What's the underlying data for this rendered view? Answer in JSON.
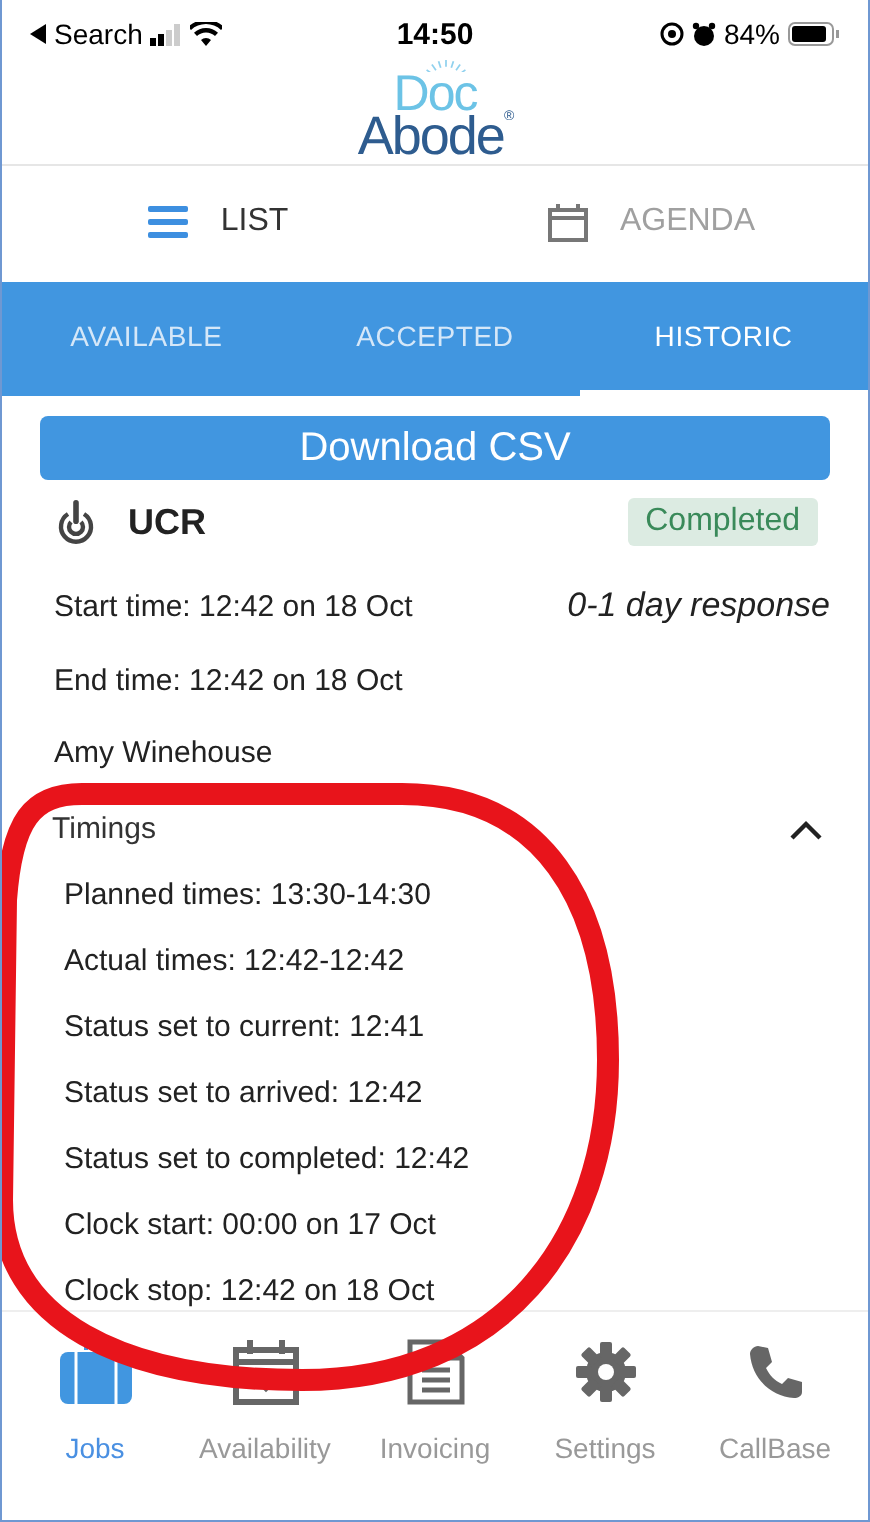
{
  "status_bar": {
    "back_label": "Search",
    "time": "14:50",
    "battery": "84%"
  },
  "logo": {
    "top": "Doc",
    "bottom": "Abode",
    "mark": "®"
  },
  "view_tabs": [
    {
      "label": "LIST",
      "selected": true
    },
    {
      "label": "AGENDA",
      "selected": false
    }
  ],
  "status_tabs": [
    {
      "label": "AVAILABLE",
      "selected": false
    },
    {
      "label": "ACCEPTED",
      "selected": false
    },
    {
      "label": "HISTORIC",
      "selected": true
    }
  ],
  "download_button": "Download CSV",
  "job": {
    "type": "UCR",
    "status": "Completed",
    "start": "Start time: 12:42 on 18 Oct",
    "response": "0-1 day response",
    "end": "End time: 12:42 on 18 Oct",
    "patient": "Amy Winehouse",
    "timings": {
      "label": "Timings",
      "expanded": true,
      "items": [
        "Planned times: 13:30-14:30",
        "Actual times: 12:42-12:42",
        "Status set to current: 12:41",
        "Status set to arrived: 12:42",
        "Status set to completed: 12:42",
        "Clock start: 00:00 on 17 Oct",
        "Clock stop: 12:42 on 18 Oct"
      ]
    }
  },
  "bottom_nav": [
    {
      "label": "Jobs",
      "selected": true
    },
    {
      "label": "Availability",
      "selected": false
    },
    {
      "label": "Invoicing",
      "selected": false
    },
    {
      "label": "Settings",
      "selected": false
    },
    {
      "label": "CallBase",
      "selected": false
    }
  ],
  "annotation": {
    "kind": "ellipse",
    "color": "#e8141b"
  }
}
